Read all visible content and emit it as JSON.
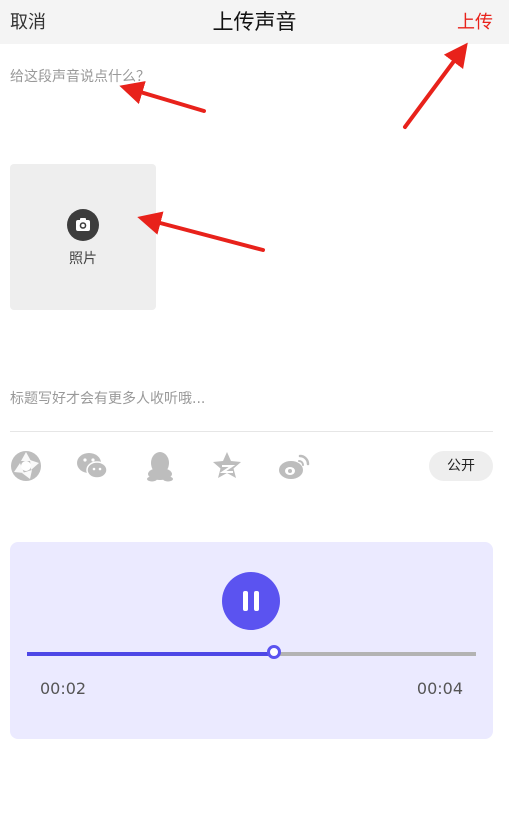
{
  "header": {
    "cancel_label": "取消",
    "title": "上传声音",
    "upload_label": "上传",
    "upload_color": "#e8221b"
  },
  "description": {
    "placeholder": "给这段声音说点什么？",
    "value": ""
  },
  "photo": {
    "label": "照片",
    "icon": "camera-icon"
  },
  "title_field": {
    "placeholder": "标题写好才会有更多人收听哦...",
    "value": ""
  },
  "share": {
    "icons": [
      "moments-icon",
      "wechat-icon",
      "qq-icon",
      "qzone-icon",
      "weibo-icon"
    ],
    "visibility_label": "公开"
  },
  "player": {
    "state": "playing",
    "current_time": "00:02",
    "total_time": "00:04",
    "progress_fraction": 0.55,
    "accent_color": "#5b53f0",
    "background_color": "#ebeaff"
  },
  "annotations": {
    "color": "#e8221b",
    "arrow_count": 3
  }
}
